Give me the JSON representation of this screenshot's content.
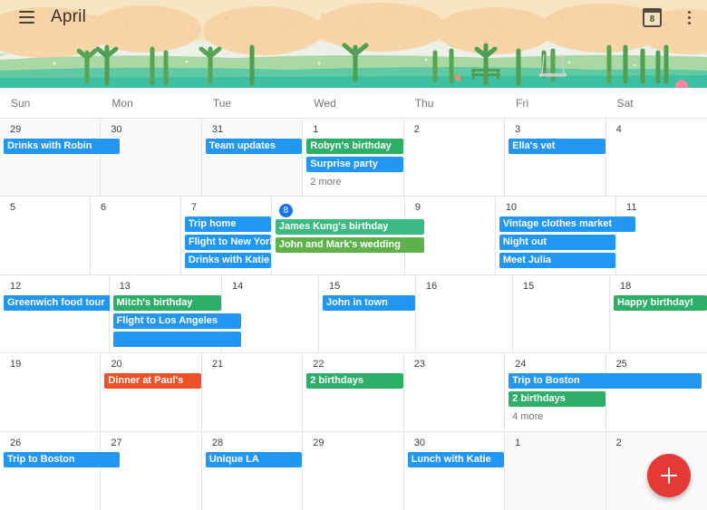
{
  "header": {
    "month_title": "April",
    "menu_icon": "hamburger-menu-icon",
    "today_icon": "calendar-today-icon",
    "today_icon_number": "8",
    "overflow_icon": "more-options-icon"
  },
  "weekdays": [
    "Sun",
    "Mon",
    "Tue",
    "Wed",
    "Thu",
    "Fri",
    "Sat"
  ],
  "colors": {
    "event_blue": "#2196f3",
    "event_green": "#2eaf68",
    "event_green_light": "#3bba83",
    "event_green_olive": "#5fb14a",
    "event_orange": "#ef5126",
    "today_blue": "#1a73e8",
    "fab_red": "#e53935"
  },
  "fab": {
    "label": "+",
    "name": "create-event-button"
  },
  "weeks": [
    {
      "days": [
        {
          "num": "29",
          "other_month": true,
          "today": false,
          "events": [
            {
              "title": "Drinks with Robin",
              "color": "#2196f3",
              "span": 1,
              "bleed": true
            }
          ],
          "more": null
        },
        {
          "num": "30",
          "other_month": true,
          "today": false,
          "events": [],
          "more": null
        },
        {
          "num": "31",
          "other_month": true,
          "today": false,
          "events": [
            {
              "title": "Team updates",
              "color": "#2196f3",
              "span": 1,
              "bleed": false
            }
          ],
          "more": null
        },
        {
          "num": "1",
          "other_month": false,
          "today": false,
          "events": [
            {
              "title": "Robyn's birthday",
              "color": "#2eaf68",
              "span": 1,
              "bleed": false
            },
            {
              "title": "Surprise party",
              "color": "#2196f3",
              "span": 1,
              "bleed": false
            }
          ],
          "more": "2 more"
        },
        {
          "num": "2",
          "other_month": false,
          "today": false,
          "events": [],
          "more": null
        },
        {
          "num": "3",
          "other_month": false,
          "today": false,
          "events": [
            {
              "title": "Ella's vet",
              "color": "#2196f3",
              "span": 1,
              "bleed": false
            }
          ],
          "more": null
        },
        {
          "num": "4",
          "other_month": false,
          "today": false,
          "events": [],
          "more": null
        }
      ]
    },
    {
      "days": [
        {
          "num": "5",
          "other_month": false,
          "today": false,
          "events": [],
          "more": null
        },
        {
          "num": "6",
          "other_month": false,
          "today": false,
          "events": [],
          "more": null
        },
        {
          "num": "7",
          "other_month": false,
          "today": false,
          "events": [
            {
              "title": "Trip home",
              "color": "#2196f3",
              "span": 1,
              "bleed": false
            },
            {
              "title": "Flight to New York",
              "color": "#2196f3",
              "span": 1,
              "bleed": false
            },
            {
              "title": "Drinks with Katie",
              "color": "#2196f3",
              "span": 1,
              "bleed": false
            }
          ],
          "more": null
        },
        {
          "num": "8",
          "other_month": false,
          "today": true,
          "events": [
            {
              "title": "James Kung's birthday",
              "color": "#3bba83",
              "span": 1,
              "bleed": true
            },
            {
              "title": "John and Mark's wedding",
              "color": "#5fb14a",
              "span": 1,
              "bleed": true
            }
          ],
          "more": null
        },
        {
          "num": "9",
          "other_month": false,
          "today": false,
          "events": [],
          "more": null
        },
        {
          "num": "10",
          "other_month": false,
          "today": false,
          "events": [
            {
              "title": "Vintage clothes market",
              "color": "#2196f3",
              "span": 1,
              "bleed": true
            },
            {
              "title": "Night out",
              "color": "#2196f3",
              "span": 1,
              "bleed": false
            },
            {
              "title": "Meet Julia",
              "color": "#2196f3",
              "span": 1,
              "bleed": false
            }
          ],
          "more": null
        },
        {
          "num": "11",
          "other_month": false,
          "today": false,
          "events": [],
          "more": null
        }
      ]
    },
    {
      "days": [
        {
          "num": "12",
          "other_month": false,
          "today": false,
          "events": [
            {
              "title": "Greenwich food tour",
              "color": "#2196f3",
              "span": 1,
              "bleed": true
            }
          ],
          "more": null
        },
        {
          "num": "13",
          "other_month": false,
          "today": false,
          "events": [
            {
              "title": "Mitch's birthday",
              "color": "#2eaf68",
              "span": 1,
              "bleed": false
            },
            {
              "title": "Flight to Los Angeles",
              "color": "#2196f3",
              "span": 1,
              "bleed": true
            },
            {
              "title": "",
              "color": "#2196f3",
              "span": 1,
              "bleed": true
            }
          ],
          "more": null
        },
        {
          "num": "14",
          "other_month": false,
          "today": false,
          "events": [],
          "more": null
        },
        {
          "num": "15",
          "other_month": false,
          "today": false,
          "events": [
            {
              "title": "John in town",
              "color": "#2196f3",
              "span": 1,
              "bleed": false
            }
          ],
          "more": null
        },
        {
          "num": "16",
          "other_month": false,
          "today": false,
          "events": [],
          "more": null
        },
        {
          "num": "15",
          "other_month": false,
          "today": false,
          "events": [],
          "more": null
        },
        {
          "num": "18",
          "other_month": false,
          "today": false,
          "events": [
            {
              "title": "Happy birthday!",
              "color": "#2eaf68",
              "span": 1,
              "bleed": false
            }
          ],
          "more": null
        }
      ]
    },
    {
      "days": [
        {
          "num": "19",
          "other_month": false,
          "today": false,
          "events": [],
          "more": null
        },
        {
          "num": "20",
          "other_month": false,
          "today": false,
          "events": [
            {
              "title": "Dinner at Paul's",
              "color": "#ef5126",
              "span": 1,
              "bleed": false
            }
          ],
          "more": null
        },
        {
          "num": "21",
          "other_month": false,
          "today": false,
          "events": [],
          "more": null
        },
        {
          "num": "22",
          "other_month": false,
          "today": false,
          "events": [
            {
              "title": "2 birthdays",
              "color": "#2eaf68",
              "span": 1,
              "bleed": false
            }
          ],
          "more": null
        },
        {
          "num": "23",
          "other_month": false,
          "today": false,
          "events": [],
          "more": null
        },
        {
          "num": "24",
          "other_month": false,
          "today": false,
          "events": [
            {
              "title": "Trip to Boston",
              "color": "#2196f3",
              "span": 2,
              "bleed": false
            },
            {
              "title": "2 birthdays",
              "color": "#2eaf68",
              "span": 1,
              "bleed": false
            }
          ],
          "more": "4 more"
        },
        {
          "num": "25",
          "other_month": false,
          "today": false,
          "events": [],
          "more": null
        }
      ]
    },
    {
      "days": [
        {
          "num": "26",
          "other_month": false,
          "today": false,
          "events": [
            {
              "title": "Trip to Boston",
              "color": "#2196f3",
              "span": 1,
              "bleed": true
            }
          ],
          "more": null
        },
        {
          "num": "27",
          "other_month": false,
          "today": false,
          "events": [],
          "more": null
        },
        {
          "num": "28",
          "other_month": false,
          "today": false,
          "events": [
            {
              "title": "Unique LA",
              "color": "#2196f3",
              "span": 1,
              "bleed": false
            }
          ],
          "more": null
        },
        {
          "num": "29",
          "other_month": false,
          "today": false,
          "events": [],
          "more": null
        },
        {
          "num": "30",
          "other_month": false,
          "today": false,
          "events": [
            {
              "title": "Lunch with Katie",
              "color": "#2196f3",
              "span": 1,
              "bleed": false
            }
          ],
          "more": null
        },
        {
          "num": "1",
          "other_month": true,
          "today": false,
          "events": [],
          "more": null
        },
        {
          "num": "2",
          "other_month": true,
          "today": false,
          "events": [],
          "more": null
        }
      ]
    }
  ]
}
